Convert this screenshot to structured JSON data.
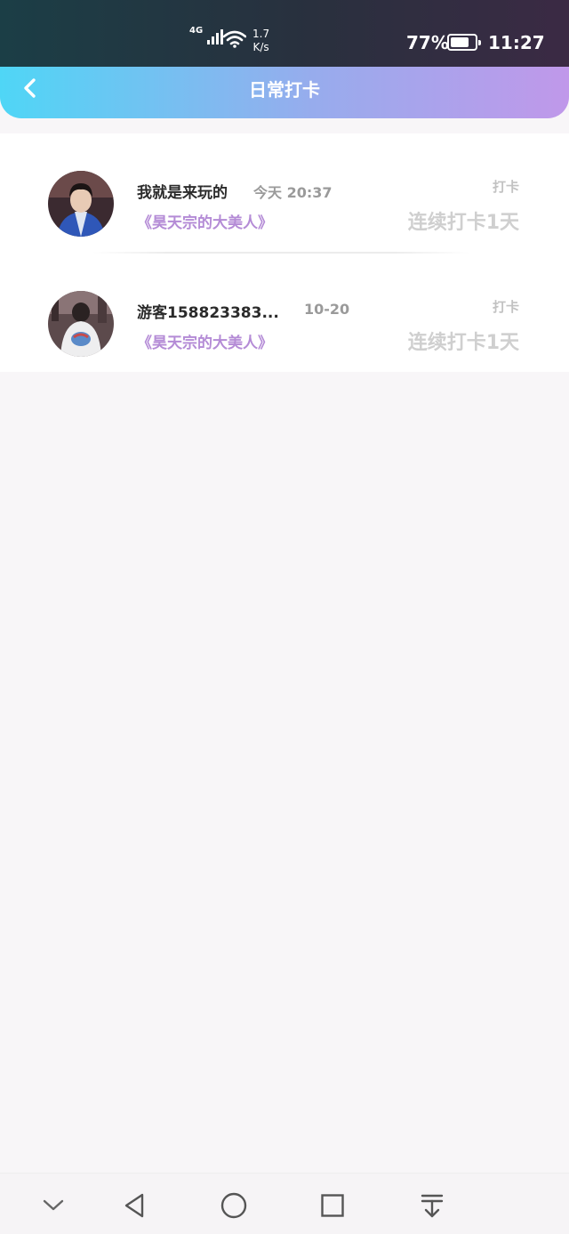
{
  "status_bar": {
    "network": "4G",
    "speed_value": "1.7",
    "speed_unit": "K/s",
    "battery_percent": "77%",
    "battery_level": 0.77,
    "time": "11:27",
    "icons": [
      "signal-icon",
      "wifi-icon",
      "battery-icon"
    ]
  },
  "header": {
    "title": "日常打卡",
    "back_icon": "chevron-left-icon",
    "gradient": [
      "#4fd6f6",
      "#c098ea"
    ]
  },
  "checkins": [
    {
      "user": "我就是来玩的",
      "time": "今天 20:37",
      "book": "《昊天宗的大美人》",
      "tag": "打卡",
      "streak": "连续打卡1天"
    },
    {
      "user": "游客158823383...",
      "time": "10-20",
      "book": "《昊天宗的大美人》",
      "tag": "打卡",
      "streak": "连续打卡1天"
    }
  ],
  "nav_bar": {
    "icons": [
      "chevron-down-icon",
      "back-triangle-icon",
      "home-circle-icon",
      "recents-square-icon",
      "download-icon"
    ]
  },
  "colors": {
    "accent_purple": "#b48bd6",
    "muted_gray": "#c2c2c2",
    "page_bg": "#f8f6f8"
  }
}
